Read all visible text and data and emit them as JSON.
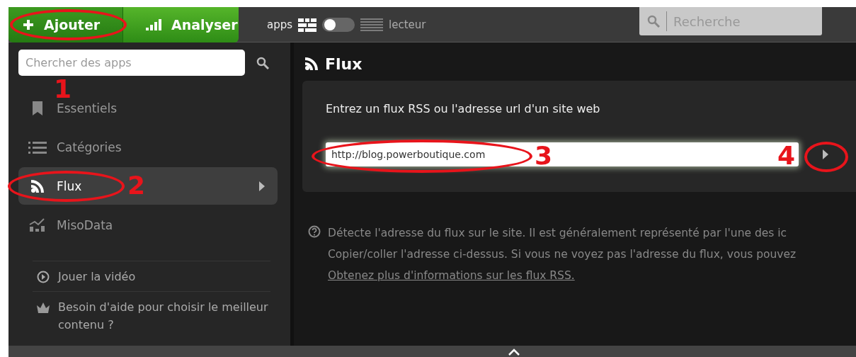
{
  "toolbar": {
    "buttons": [
      {
        "label": "Ajouter",
        "kind": "add"
      },
      {
        "label": "Analyser",
        "kind": "analyze"
      }
    ],
    "view_toggle": {
      "left_label": "apps",
      "right_label": "lecteur",
      "on": false
    },
    "search": {
      "placeholder": "Recherche"
    }
  },
  "sidebar": {
    "search": {
      "placeholder": "Chercher des apps"
    },
    "items": [
      {
        "label": "Essentiels",
        "kind": "bookmark",
        "selected": false
      },
      {
        "label": "Catégories",
        "kind": "list",
        "selected": false
      },
      {
        "label": "Flux",
        "kind": "rss",
        "selected": true
      },
      {
        "label": "MisoData",
        "kind": "chart",
        "selected": false
      }
    ],
    "links": [
      {
        "label": "Jouer la vidéo",
        "kind": "video"
      },
      {
        "label": "Besoin d'aide pour choisir le meilleur contenu ?",
        "kind": "crown"
      }
    ]
  },
  "main": {
    "title": "Flux",
    "prompt": "Entrez un flux RSS ou l'adresse url d'un site web",
    "url_field": {
      "value": "http://blog.powerboutique.com"
    },
    "help_lines": [
      "Détecte l'adresse du flux sur le site. Il est généralement représenté par l'une des ic",
      "Copier/coller l'adresse ci-dessus. Si vous ne voyez pas l'adresse du flux, vous pouvez"
    ],
    "help_link": "Obtenez plus d'informations sur les flux RSS."
  },
  "annotations": [
    {
      "label": "1"
    },
    {
      "label": "2"
    },
    {
      "label": "3"
    },
    {
      "label": "4"
    }
  ]
}
